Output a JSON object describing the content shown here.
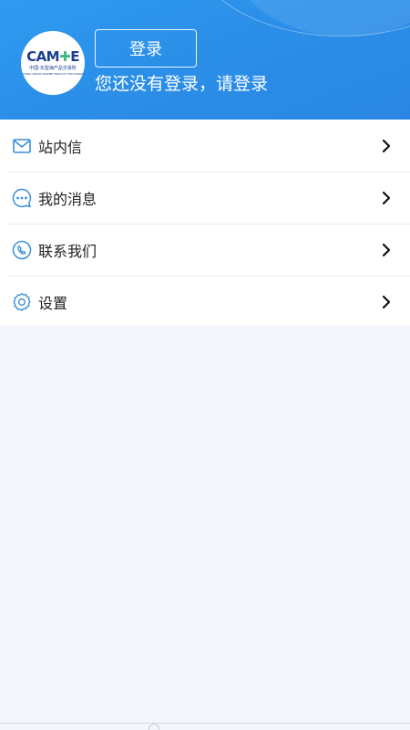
{
  "header": {
    "logo_text": "CAMPE",
    "logo_subtitle": "中国-东盟海产品交易所",
    "logo_subtitle_en": "CHINA-ASEAN MARINE PRODUCT EXCHANGE",
    "login_button": "登录",
    "login_hint": "您还没有登录，请登录"
  },
  "menu": {
    "items": [
      {
        "label": "站内信",
        "icon": "mail-icon"
      },
      {
        "label": "我的消息",
        "icon": "chat-bubble-icon"
      },
      {
        "label": "联系我们",
        "icon": "phone-icon"
      },
      {
        "label": "设置",
        "icon": "gear-icon"
      }
    ]
  },
  "colors": {
    "header_blue": "#2b8fe8",
    "icon_blue": "#3a8fd8",
    "background": "#f3f6fb"
  }
}
